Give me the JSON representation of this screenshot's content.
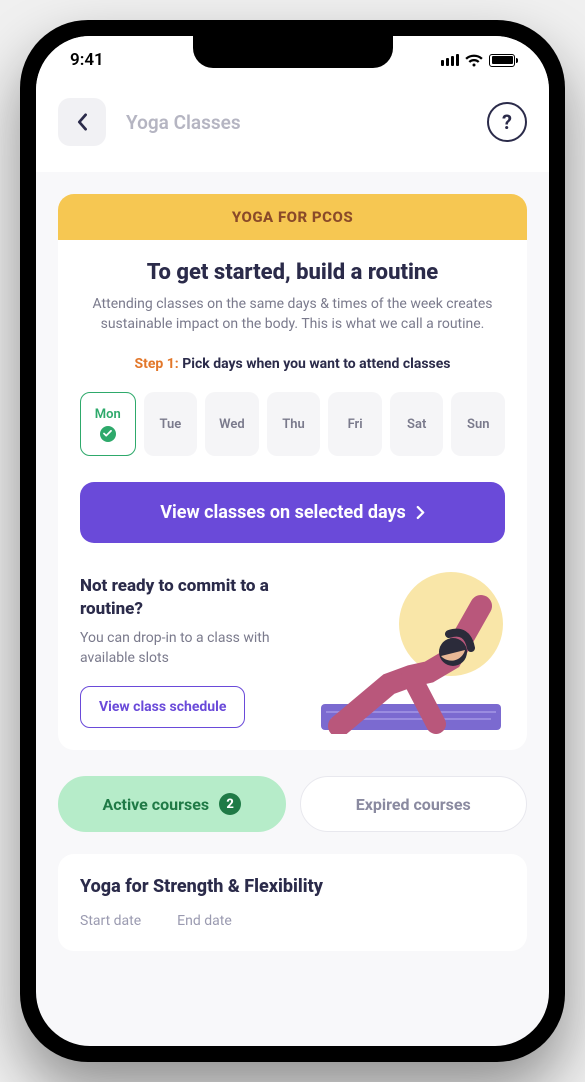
{
  "statusBar": {
    "time": "9:41"
  },
  "header": {
    "title": "Yoga Classes"
  },
  "routineCard": {
    "banner": "YOGA FOR PCOS",
    "title": "To get started, build a routine",
    "description": "Attending classes on the same days & times of the week creates sustainable impact on the body. This is what we call a routine.",
    "stepLabel": "Step 1:",
    "stepText": "Pick days when you want to attend classes",
    "days": [
      {
        "label": "Mon",
        "selected": true
      },
      {
        "label": "Tue",
        "selected": false
      },
      {
        "label": "Wed",
        "selected": false
      },
      {
        "label": "Thu",
        "selected": false
      },
      {
        "label": "Fri",
        "selected": false
      },
      {
        "label": "Sat",
        "selected": false
      },
      {
        "label": "Sun",
        "selected": false
      }
    ],
    "primaryButton": "View classes on selected days",
    "dropin": {
      "title": "Not ready to commit to a routine?",
      "description": "You can drop-in to a class with available slots",
      "button": "View class schedule"
    }
  },
  "tabs": {
    "active": {
      "label": "Active courses",
      "count": 2
    },
    "expired": {
      "label": "Expired courses"
    }
  },
  "course": {
    "title": "Yoga for Strength & Flexibility",
    "startLabel": "Start date",
    "endLabel": "End date"
  }
}
